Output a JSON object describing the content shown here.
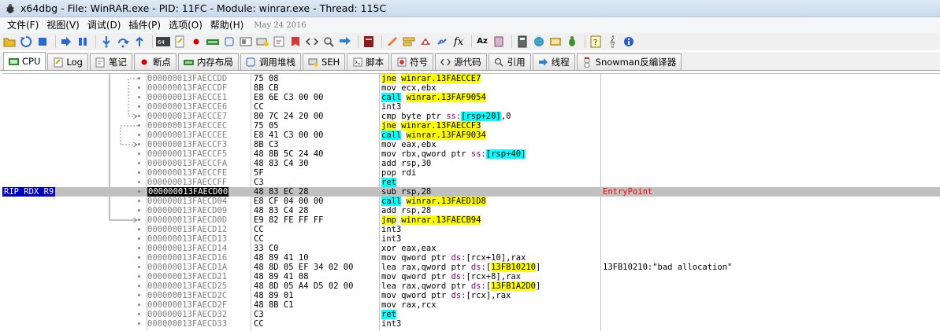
{
  "window": {
    "title": "x64dbg - File: WinRAR.exe - PID: 11FC - Module: winrar.exe - Thread: 115C"
  },
  "menu": {
    "items": [
      "文件(F)",
      "视图(V)",
      "调试(D)",
      "插件(P)",
      "选项(O)",
      "帮助(H)"
    ],
    "date": "May 24 2016"
  },
  "toolbar": {
    "icons": [
      "open-icon",
      "restart-icon",
      "stop-icon",
      "run-icon",
      "pause-icon",
      "step-into-icon",
      "step-over-icon",
      "execute-till-return-icon",
      "cpu-mode-icon",
      "log-icon",
      "breakpoint-icon",
      "memory-map-icon",
      "handles-icon",
      "callstack-icon",
      "seh-icon",
      "script-icon",
      "symbols-icon",
      "source-icon",
      "references-icon",
      "threads-icon",
      "patch-icon",
      "comments-icon",
      "labels-icon",
      "bookmarks-icon",
      "functions-icon",
      "font-icon",
      "calculator-icon",
      "settings-icon",
      "check-update-icon",
      "bug-icon",
      "help-icon",
      "music-icon",
      "info-icon"
    ]
  },
  "tabs": [
    {
      "label": "CPU",
      "icon": "cpu-icon",
      "active": true
    },
    {
      "label": "Log",
      "icon": "log-icon"
    },
    {
      "label": "笔记",
      "icon": "notes-icon"
    },
    {
      "label": "断点",
      "icon": "breakpoint-dot-icon"
    },
    {
      "label": "内存布局",
      "icon": "memory-icon"
    },
    {
      "label": "调用堆栈",
      "icon": "callstack-icon"
    },
    {
      "label": "SEH",
      "icon": "seh-icon"
    },
    {
      "label": "脚本",
      "icon": "script-icon"
    },
    {
      "label": "符号",
      "icon": "symbols-icon"
    },
    {
      "label": "源代码",
      "icon": "source-code-icon"
    },
    {
      "label": "引用",
      "icon": "search-icon"
    },
    {
      "label": "线程",
      "icon": "threads-icon"
    },
    {
      "label": "Snowman反编译器",
      "icon": "snowman-icon"
    }
  ],
  "disasm": {
    "rip_label": "RIP RDX R9",
    "rows": [
      {
        "addr": "000000013FAECCDD",
        "bytes": "75 08",
        "mn": "jne",
        "ops": "winrar.13FAECCE7",
        "kind": "jmp"
      },
      {
        "addr": "000000013FAECCDF",
        "bytes": "8B CB",
        "mn": "mov",
        "ops": "ecx,ebx",
        "kind": ""
      },
      {
        "addr": "000000013FAECCE1",
        "bytes": "E8 6E C3 00 00",
        "mn": "call",
        "ops": "winrar.13FAF9054",
        "kind": "call"
      },
      {
        "addr": "000000013FAECCE6",
        "bytes": "CC",
        "mn": "int3",
        "ops": "",
        "kind": ""
      },
      {
        "addr": "000000013FAECCE7",
        "bytes": "80 7C 24 20 00",
        "mn": "cmp",
        "ops": "byte ptr ss:[rsp+20],0",
        "kind": "mem",
        "seg": "ss:",
        "br": "[rsp+20]",
        "tail": ",0",
        "pre": "byte ptr "
      },
      {
        "addr": "000000013FAECCEC",
        "bytes": "75 05",
        "mn": "jne",
        "ops": "winrar.13FAECCF3",
        "kind": "jmp"
      },
      {
        "addr": "000000013FAECCEE",
        "bytes": "E8 41 C3 00 00",
        "mn": "call",
        "ops": "winrar.13FAF9034",
        "kind": "call"
      },
      {
        "addr": "000000013FAECCF3",
        "bytes": "8B C3",
        "mn": "mov",
        "ops": "eax,ebx",
        "kind": ""
      },
      {
        "addr": "000000013FAECCF5",
        "bytes": "48 8B 5C 24 40",
        "mn": "mov",
        "ops": "rbx,qword ptr ss:[rsp+40]",
        "kind": "mem",
        "seg": "ss:",
        "br": "[rsp+40]",
        "tail": "",
        "pre": "rbx,qword ptr "
      },
      {
        "addr": "000000013FAECCFA",
        "bytes": "48 83 C4 30",
        "mn": "add",
        "ops": "rsp,30",
        "kind": ""
      },
      {
        "addr": "000000013FAECCFE",
        "bytes": "5F",
        "mn": "pop",
        "ops": "rdi",
        "kind": ""
      },
      {
        "addr": "000000013FAECCFF",
        "bytes": "C3",
        "mn": "ret",
        "ops": "",
        "kind": "ret"
      },
      {
        "addr": "000000013FAECD00",
        "bytes": "48 83 EC 28",
        "mn": "sub",
        "ops": "rsp,28",
        "kind": "",
        "selected": true,
        "comment": "EntryPoint"
      },
      {
        "addr": "000000013FAECD04",
        "bytes": "E8 CF 04 00 00",
        "mn": "call",
        "ops": "winrar.13FAED1D8",
        "kind": "call"
      },
      {
        "addr": "000000013FAECD09",
        "bytes": "48 83 C4 28",
        "mn": "add",
        "ops": "rsp,28",
        "kind": ""
      },
      {
        "addr": "000000013FAECD0D",
        "bytes": "E9 82 FE FF FF",
        "mn": "jmp",
        "ops": "winrar.13FAECB94",
        "kind": "jmp"
      },
      {
        "addr": "000000013FAECD12",
        "bytes": "CC",
        "mn": "int3",
        "ops": "",
        "kind": ""
      },
      {
        "addr": "000000013FAECD13",
        "bytes": "CC",
        "mn": "int3",
        "ops": "",
        "kind": ""
      },
      {
        "addr": "000000013FAECD14",
        "bytes": "33 C0",
        "mn": "xor",
        "ops": "eax,eax",
        "kind": ""
      },
      {
        "addr": "000000013FAECD16",
        "bytes": "48 89 41 10",
        "mn": "mov",
        "ops": "qword ptr ds:[rcx+10],rax",
        "kind": "mem2",
        "seg": "ds:",
        "br": "[rcx+10]",
        "tail": ",rax",
        "pre": "qword ptr "
      },
      {
        "addr": "000000013FAECD1A",
        "bytes": "48 8D 05 EF 34 02 00",
        "mn": "lea",
        "ops": "rax,qword ptr ds:[13FB10210]",
        "kind": "memaddr",
        "seg": "ds:",
        "br": "13FB10210",
        "pre": "rax,qword ptr ",
        "comment": "13FB10210:\"bad allocation\""
      },
      {
        "addr": "000000013FAECD21",
        "bytes": "48 89 41 08",
        "mn": "mov",
        "ops": "qword ptr ds:[rcx+8],rax",
        "kind": "mem2",
        "seg": "ds:",
        "br": "[rcx+8]",
        "tail": ",rax",
        "pre": "qword ptr "
      },
      {
        "addr": "000000013FAECD25",
        "bytes": "48 8D 05 A4 D5 02 00",
        "mn": "lea",
        "ops": "rax,qword ptr ds:[13FB1A2D0]",
        "kind": "memaddr",
        "seg": "ds:",
        "br": "13FB1A2D0",
        "pre": "rax,qword ptr "
      },
      {
        "addr": "000000013FAECD2C",
        "bytes": "48 89 01",
        "mn": "mov",
        "ops": "qword ptr ds:[rcx],rax",
        "kind": "mem2",
        "seg": "ds:",
        "br": "[rcx]",
        "tail": ",rax",
        "pre": "qword ptr "
      },
      {
        "addr": "000000013FAECD2F",
        "bytes": "48 8B C1",
        "mn": "mov",
        "ops": "rax,rcx",
        "kind": ""
      },
      {
        "addr": "000000013FAECD32",
        "bytes": "C3",
        "mn": "ret",
        "ops": "",
        "kind": "ret"
      },
      {
        "addr": "000000013FAECD33",
        "bytes": "CC",
        "mn": "int3",
        "ops": "",
        "kind": ""
      }
    ]
  },
  "colors": {
    "jump_highlight": "#ffff00",
    "call_highlight": "#00ffff",
    "selected_row": "#c0c0c0",
    "rip_label_bg": "#0000c0",
    "entry_comment": "#ff0000"
  }
}
